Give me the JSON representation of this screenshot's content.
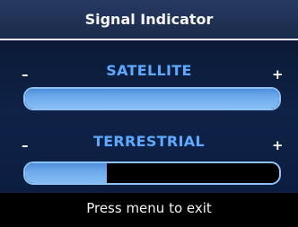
{
  "header": {
    "title": "Signal Indicator"
  },
  "signals": [
    {
      "label": "SATELLITE",
      "minus": "–",
      "plus": "+",
      "level": 1.0
    },
    {
      "label": "TERRESTRIAL",
      "minus": "–",
      "plus": "+",
      "level": 0.32
    }
  ],
  "footer": {
    "hint": "Press menu to exit"
  },
  "colors": {
    "accent": "#5ea9ff",
    "bar_border": "#8ec1f5",
    "bar_fill": "#6fa9ec"
  }
}
